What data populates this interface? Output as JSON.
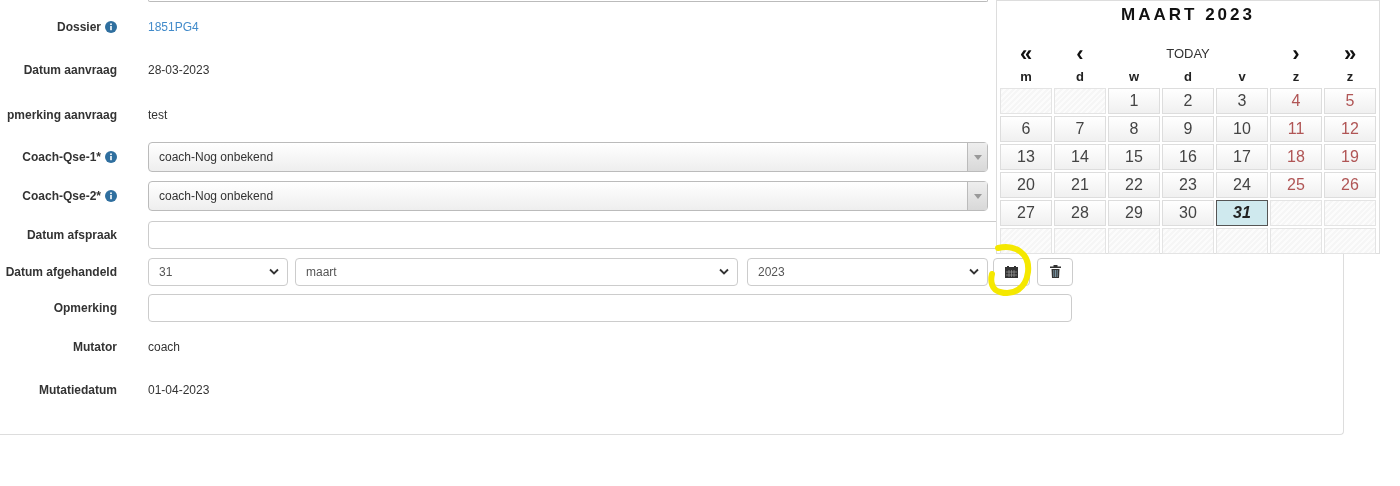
{
  "form": {
    "rows": [
      {
        "kind": "link",
        "label": "Dossier",
        "info": true,
        "value": "1851PG4"
      },
      {
        "kind": "text",
        "label": "Datum aanvraag",
        "info": false,
        "value": "28-03-2023"
      },
      {
        "kind": "text",
        "label": "pmerking aanvraag",
        "info": false,
        "value": "test"
      },
      {
        "kind": "select",
        "label": "Coach-Qse-1*",
        "info": true,
        "value": "coach-Nog onbekend"
      },
      {
        "kind": "select",
        "label": "Coach-Qse-2*",
        "info": true,
        "value": "coach-Nog onbekend"
      },
      {
        "kind": "input",
        "label": "Datum afspraak",
        "info": false
      },
      {
        "kind": "date",
        "label": "Datum afgehandeld",
        "info": false,
        "day": "31",
        "month": "maart",
        "year": "2023"
      },
      {
        "kind": "input",
        "label": "Opmerking",
        "info": false
      },
      {
        "kind": "text",
        "label": "Mutator",
        "info": false,
        "value": "coach"
      },
      {
        "kind": "text",
        "label": "Mutatiedatum",
        "info": false,
        "value": "01-04-2023"
      }
    ]
  },
  "calendar": {
    "title": "MAART 2023",
    "nav": [
      "«",
      "‹",
      "TODAY",
      "›",
      "»"
    ],
    "weekdays": [
      "m",
      "d",
      "w",
      "d",
      "v",
      "z",
      "z"
    ],
    "cells": [
      {
        "kind": "empty"
      },
      {
        "kind": "empty"
      },
      {
        "kind": "day",
        "label": "1",
        "weekend": false,
        "selected": false
      },
      {
        "kind": "day",
        "label": "2",
        "weekend": false,
        "selected": false
      },
      {
        "kind": "day",
        "label": "3",
        "weekend": false,
        "selected": false
      },
      {
        "kind": "day",
        "label": "4",
        "weekend": true,
        "selected": false
      },
      {
        "kind": "day",
        "label": "5",
        "weekend": true,
        "selected": false
      },
      {
        "kind": "day",
        "label": "6",
        "weekend": false,
        "selected": false
      },
      {
        "kind": "day",
        "label": "7",
        "weekend": false,
        "selected": false
      },
      {
        "kind": "day",
        "label": "8",
        "weekend": false,
        "selected": false
      },
      {
        "kind": "day",
        "label": "9",
        "weekend": false,
        "selected": false
      },
      {
        "kind": "day",
        "label": "10",
        "weekend": false,
        "selected": false
      },
      {
        "kind": "day",
        "label": "11",
        "weekend": true,
        "selected": false
      },
      {
        "kind": "day",
        "label": "12",
        "weekend": true,
        "selected": false
      },
      {
        "kind": "day",
        "label": "13",
        "weekend": false,
        "selected": false
      },
      {
        "kind": "day",
        "label": "14",
        "weekend": false,
        "selected": false
      },
      {
        "kind": "day",
        "label": "15",
        "weekend": false,
        "selected": false
      },
      {
        "kind": "day",
        "label": "16",
        "weekend": false,
        "selected": false
      },
      {
        "kind": "day",
        "label": "17",
        "weekend": false,
        "selected": false
      },
      {
        "kind": "day",
        "label": "18",
        "weekend": true,
        "selected": false
      },
      {
        "kind": "day",
        "label": "19",
        "weekend": true,
        "selected": false
      },
      {
        "kind": "day",
        "label": "20",
        "weekend": false,
        "selected": false
      },
      {
        "kind": "day",
        "label": "21",
        "weekend": false,
        "selected": false
      },
      {
        "kind": "day",
        "label": "22",
        "weekend": false,
        "selected": false
      },
      {
        "kind": "day",
        "label": "23",
        "weekend": false,
        "selected": false
      },
      {
        "kind": "day",
        "label": "24",
        "weekend": false,
        "selected": false
      },
      {
        "kind": "day",
        "label": "25",
        "weekend": true,
        "selected": false
      },
      {
        "kind": "day",
        "label": "26",
        "weekend": true,
        "selected": false
      },
      {
        "kind": "day",
        "label": "27",
        "weekend": false,
        "selected": false
      },
      {
        "kind": "day",
        "label": "28",
        "weekend": false,
        "selected": false
      },
      {
        "kind": "day",
        "label": "29",
        "weekend": false,
        "selected": false
      },
      {
        "kind": "day",
        "label": "30",
        "weekend": false,
        "selected": false
      },
      {
        "kind": "day",
        "label": "31",
        "weekend": false,
        "selected": true
      },
      {
        "kind": "empty"
      },
      {
        "kind": "empty"
      },
      {
        "kind": "empty"
      },
      {
        "kind": "empty"
      },
      {
        "kind": "empty"
      },
      {
        "kind": "empty"
      },
      {
        "kind": "empty"
      },
      {
        "kind": "empty"
      },
      {
        "kind": "empty"
      }
    ]
  },
  "annotation": {
    "kind": "highlight"
  }
}
